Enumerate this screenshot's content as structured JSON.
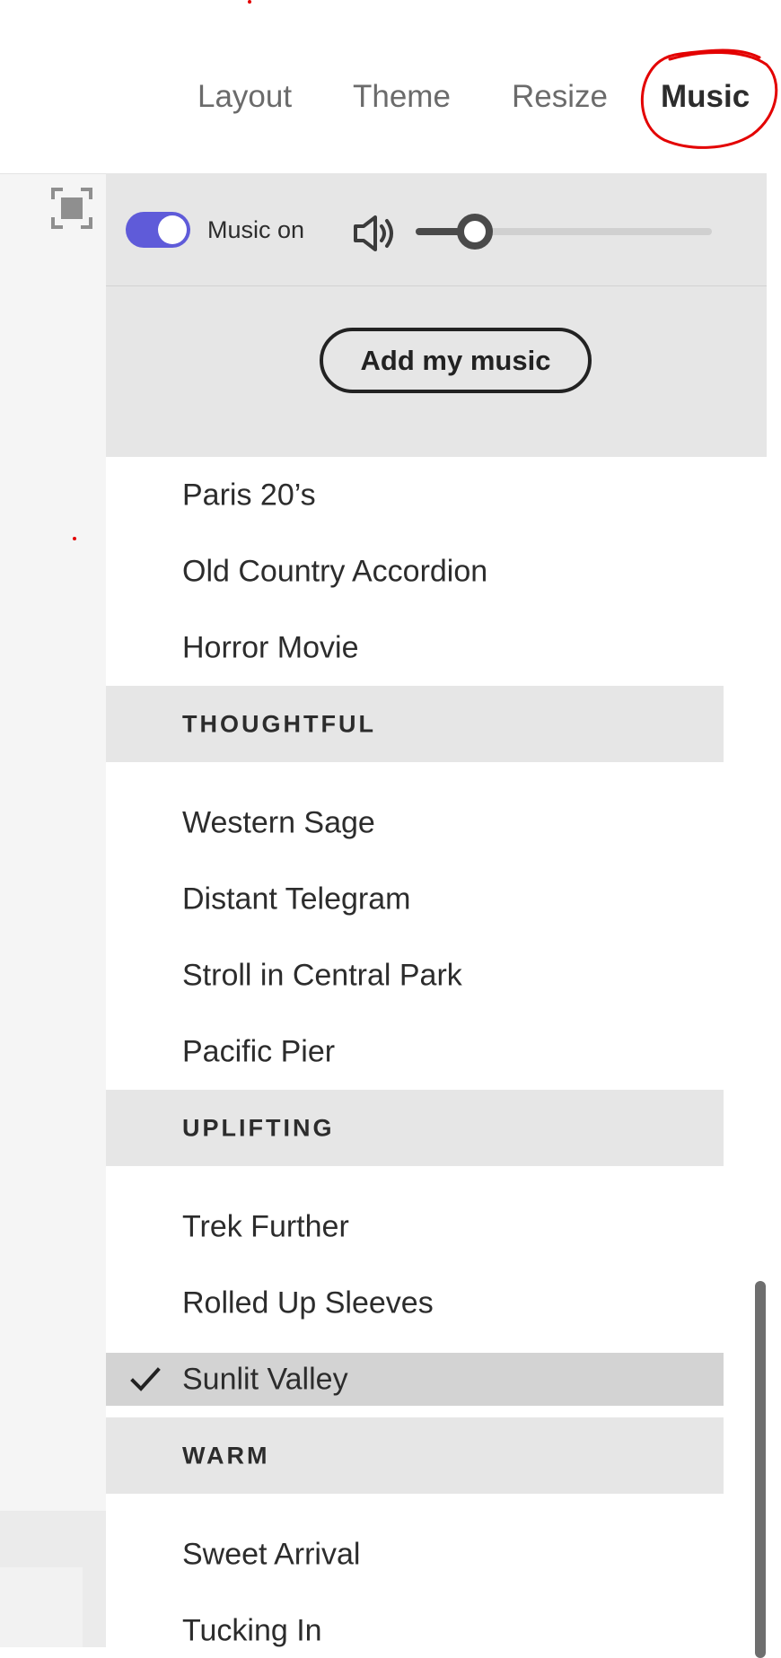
{
  "tabs": [
    {
      "label": "Layout",
      "active": false
    },
    {
      "label": "Theme",
      "active": false
    },
    {
      "label": "Resize",
      "active": false
    },
    {
      "label": "Music",
      "active": true
    }
  ],
  "annotation_color": "#e30000",
  "toolbar": {
    "fit_icon": "fit-to-screen-icon"
  },
  "music_panel": {
    "toggle_label": "Music on",
    "toggle_on": true,
    "toggle_color": "#5f5bd9",
    "volume_icon": "speaker-icon",
    "volume_level": 0.2,
    "add_music_label": "Add my music"
  },
  "track_list": {
    "tracks_top": [
      "Paris 20’s",
      "Old Country Accordion",
      "Horror Movie"
    ],
    "categories": [
      "THOUGHTFUL",
      "UPLIFTING",
      "WARM"
    ],
    "thoughtful": [
      "Western Sage",
      "Distant Telegram",
      "Stroll in Central Park",
      "Pacific Pier"
    ],
    "uplifting": [
      "Trek Further",
      "Rolled Up Sleeves",
      "Sunlit Valley"
    ],
    "selected": "Sunlit Valley",
    "selected_icon": "checkmark-icon",
    "warm": [
      "Sweet Arrival",
      "Tucking In"
    ]
  }
}
